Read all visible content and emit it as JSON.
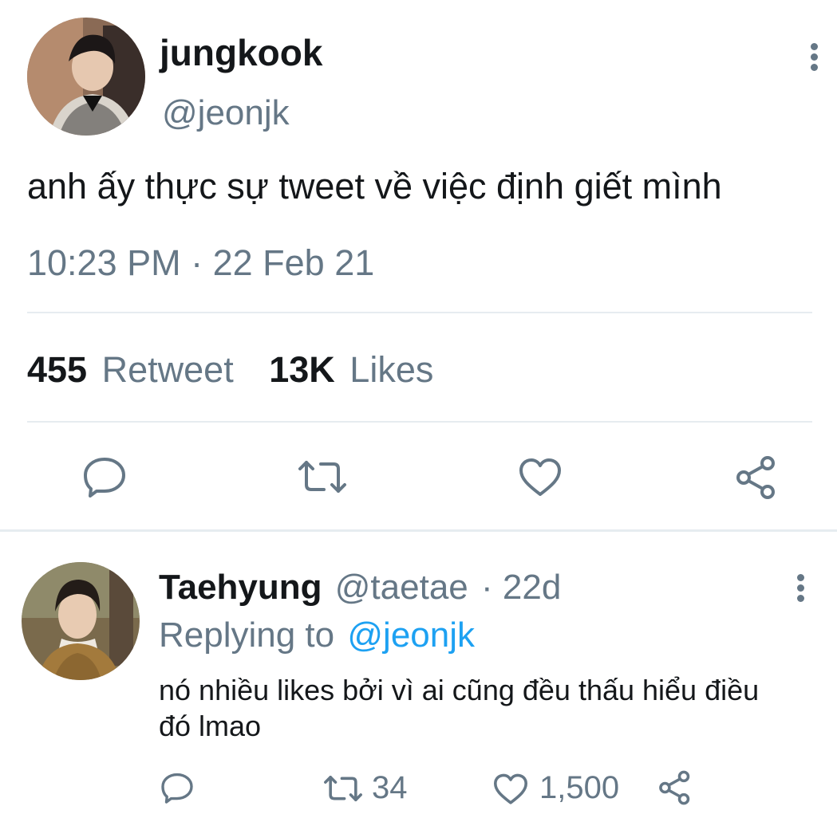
{
  "main_tweet": {
    "display_name": "jungkook",
    "handle": "@jeonjk",
    "text": "anh ấy thực sự tweet về việc định giết mình",
    "timestamp": "10:23 PM · 22 Feb 21",
    "stats": {
      "retweet_count": "455",
      "retweet_label": "Retweet",
      "likes_count": "13K",
      "likes_label": "Likes"
    }
  },
  "reply": {
    "display_name": "Taehyung",
    "handle": "@taetae",
    "age": "· 22d",
    "replying_prefix": "Replying to",
    "replying_handle": "@jeonjk",
    "text_line1": "nó nhiều likes bởi vì ai cũng đều thấu hiểu điều",
    "text_line2": "đó lmao",
    "retweet_count": "34",
    "like_count": "1,500"
  },
  "icons": [
    "more-vertical-icon",
    "reply-icon",
    "retweet-icon",
    "like-icon",
    "share-icon"
  ],
  "colors": {
    "text": "#14171a",
    "muted": "#657786",
    "link": "#1da1f2",
    "divider": "#e6ecf0"
  }
}
